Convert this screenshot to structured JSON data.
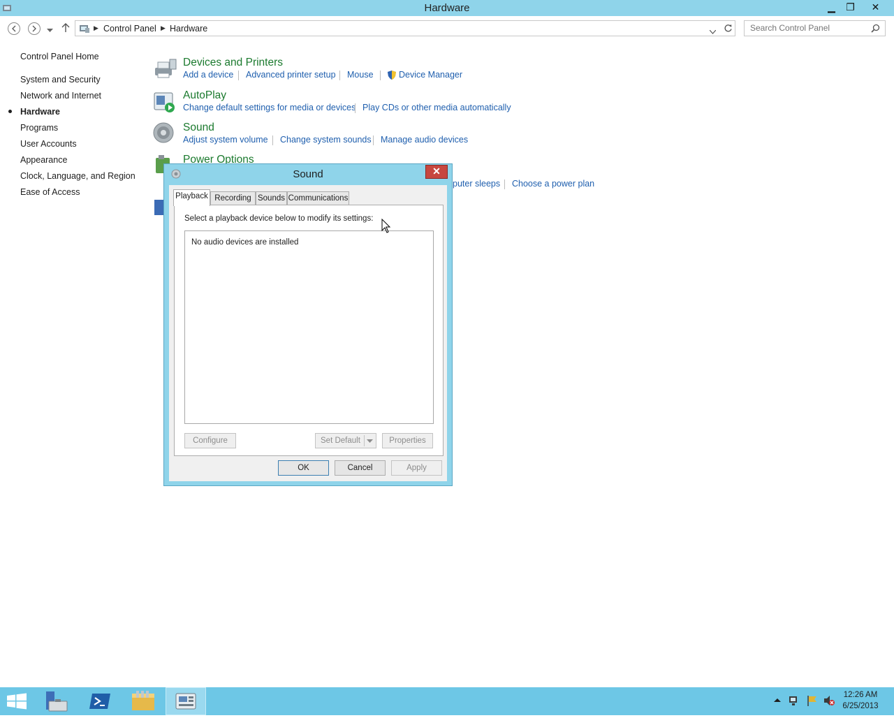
{
  "window": {
    "title": "Hardware",
    "controls": {
      "minimize": "▁",
      "restore": "❐",
      "close": "✕"
    }
  },
  "address": {
    "crumbs": [
      "Control Panel",
      "Hardware"
    ],
    "search_placeholder": "Search Control Panel"
  },
  "sidebar": {
    "home": "Control Panel Home",
    "items": [
      {
        "label": "System and Security",
        "active": false
      },
      {
        "label": "Network and Internet",
        "active": false
      },
      {
        "label": "Hardware",
        "active": true
      },
      {
        "label": "Programs",
        "active": false
      },
      {
        "label": "User Accounts",
        "active": false
      },
      {
        "label": "Appearance",
        "active": false
      },
      {
        "label": "Clock, Language, and Region",
        "active": false
      },
      {
        "label": "Ease of Access",
        "active": false
      }
    ]
  },
  "sections": {
    "devices": {
      "title": "Devices and Printers",
      "links": [
        "Add a device",
        "Advanced printer setup",
        "Mouse",
        "Device Manager"
      ]
    },
    "autoplay": {
      "title": "AutoPlay",
      "links": [
        "Change default settings for media or devices",
        "Play CDs or other media automatically"
      ]
    },
    "sound": {
      "title": "Sound",
      "links": [
        "Adjust system volume",
        "Change system sounds",
        "Manage audio devices"
      ]
    },
    "power": {
      "title": "Power Options",
      "links": [
        "puter sleeps",
        "Choose a power plan"
      ]
    }
  },
  "dialog": {
    "title": "Sound",
    "close": "✕",
    "tabs": [
      "Playback",
      "Recording",
      "Sounds",
      "Communications"
    ],
    "active_tab": "Playback",
    "instruction": "Select a playback device below to modify its settings:",
    "empty_message": "No audio devices are installed",
    "buttons": {
      "configure": "Configure",
      "set_default": "Set Default",
      "properties": "Properties",
      "ok": "OK",
      "cancel": "Cancel",
      "apply": "Apply"
    }
  },
  "taskbar": {
    "time": "12:26 AM",
    "date": "6/25/2013",
    "color": "#6dc7e6"
  },
  "colors": {
    "accent": "#8fd4ea",
    "section_title": "#1b7a2e",
    "link": "#1f5fae"
  }
}
